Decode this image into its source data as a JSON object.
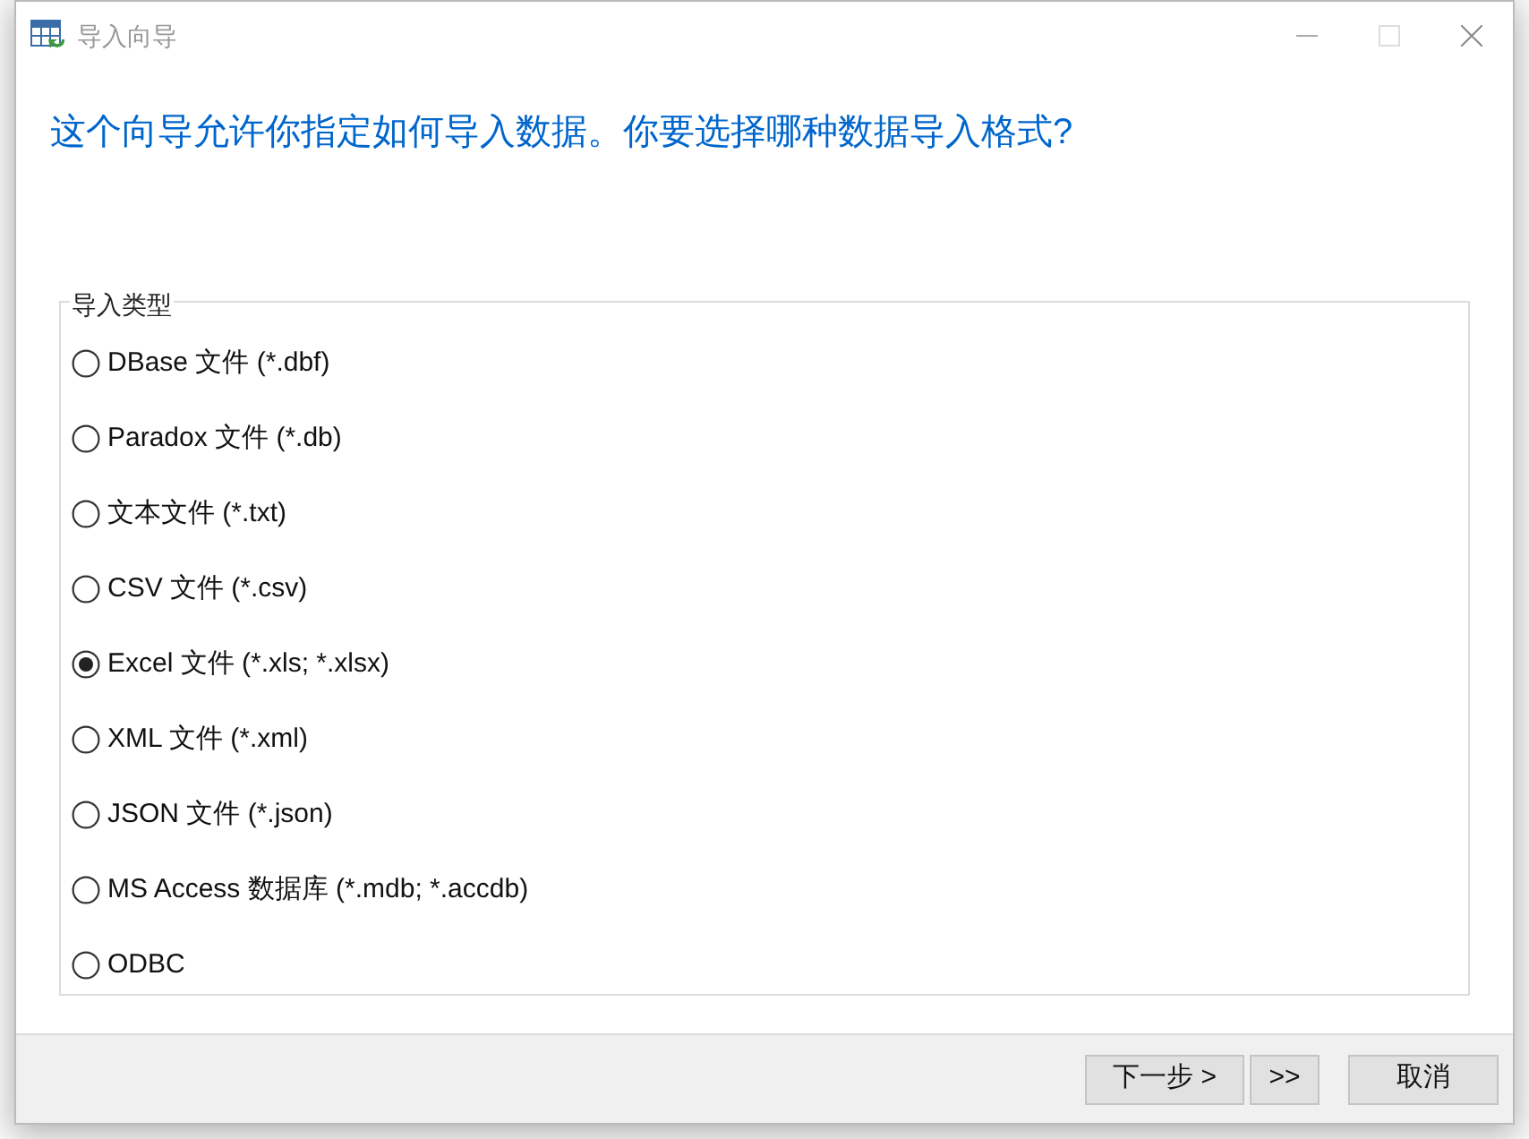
{
  "window": {
    "title": "导入向导"
  },
  "heading": "这个向导允许你指定如何导入数据。你要选择哪种数据导入格式?",
  "import_type": {
    "label": "导入类型",
    "options": [
      {
        "label": "DBase 文件 (*.dbf)",
        "selected": false
      },
      {
        "label": "Paradox 文件 (*.db)",
        "selected": false
      },
      {
        "label": "文本文件 (*.txt)",
        "selected": false
      },
      {
        "label": "CSV 文件 (*.csv)",
        "selected": false
      },
      {
        "label": "Excel 文件 (*.xls; *.xlsx)",
        "selected": true
      },
      {
        "label": "XML 文件 (*.xml)",
        "selected": false
      },
      {
        "label": "JSON 文件 (*.json)",
        "selected": false
      },
      {
        "label": "MS Access 数据库 (*.mdb; *.accdb)",
        "selected": false
      },
      {
        "label": "ODBC",
        "selected": false
      }
    ]
  },
  "buttons": [
    {
      "label": "下一步 >"
    },
    {
      "label": ">>"
    },
    {
      "label": "取消"
    }
  ]
}
